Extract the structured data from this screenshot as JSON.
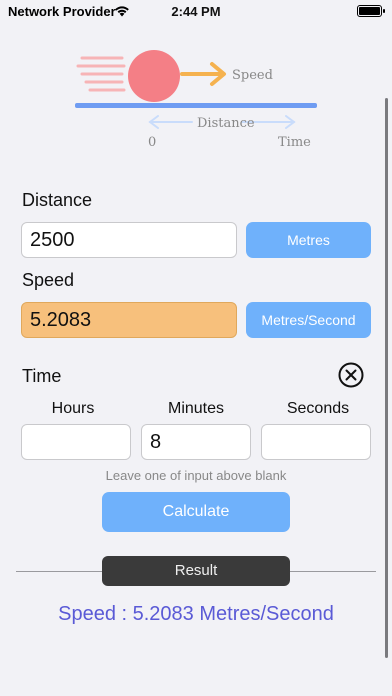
{
  "status_bar": {
    "carrier": "Network Provider",
    "time": "2:44 PM"
  },
  "illustration": {
    "speed_label": "Speed",
    "distance_label": "Distance",
    "start_label": "0",
    "time_label": "Time"
  },
  "distance": {
    "label": "Distance",
    "value": "2500",
    "unit_button": "Metres"
  },
  "speed": {
    "label": "Speed",
    "value": "5.2083",
    "unit_button": "Metres/Second"
  },
  "time": {
    "label": "Time",
    "hours_label": "Hours",
    "minutes_label": "Minutes",
    "seconds_label": "Seconds",
    "hours_value": "",
    "minutes_value": "8",
    "seconds_value": "",
    "hint": "Leave one of input above blank"
  },
  "actions": {
    "calculate_label": "Calculate"
  },
  "result": {
    "header": "Result",
    "text": "Speed : 5.2083 Metres/Second"
  },
  "colors": {
    "accent_blue": "#6fb1fb",
    "highlight_orange": "#f7c07c",
    "result_text": "#5a5ad6",
    "ball": "#f47f86",
    "track": "#6f9cf2",
    "arrow": "#f5b24f"
  }
}
